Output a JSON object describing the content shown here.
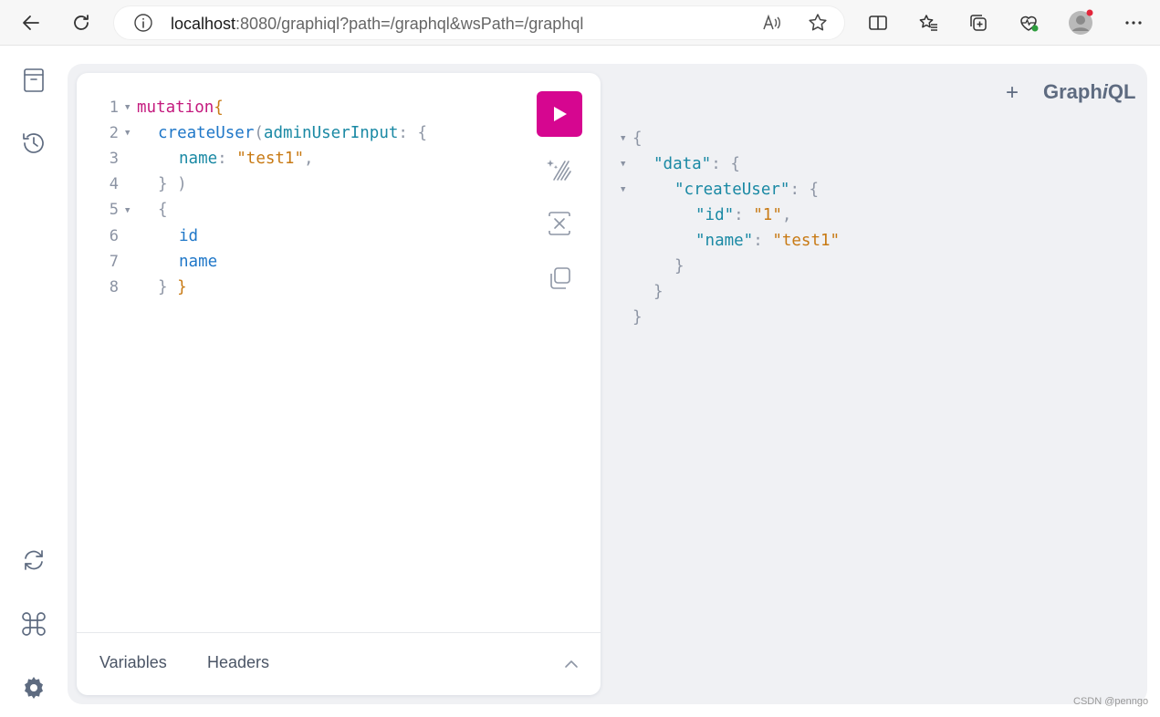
{
  "browser": {
    "url_host": "localhost",
    "url_rest": ":8080/graphiql?path=/graphql&wsPath=/graphql",
    "icons": [
      "back-icon",
      "refresh-icon",
      "info-icon",
      "read-aloud-icon",
      "favorite-star-icon",
      "split-screen-icon",
      "favorites-icon",
      "collections-icon",
      "performance-icon",
      "profile-avatar",
      "more-icon"
    ]
  },
  "sidebar": {
    "items": [
      "docs-icon",
      "history-icon",
      "refetch-schema-icon",
      "shortcuts-icon",
      "settings-icon"
    ]
  },
  "editor": {
    "line_numbers": [
      "1",
      "2",
      "3",
      "4",
      "5",
      "6",
      "7",
      "8"
    ],
    "l1_kw": "mutation",
    "l1_brace": "{",
    "l2_field": "createUser",
    "l2_paren": "(",
    "l2_arg": "adminUserInput",
    "l2_colon": ":",
    "l2_brace": "{",
    "l3_arg": "name",
    "l3_colon": ":",
    "l3_str": "\"test1\"",
    "l3_comma": ",",
    "l4_close": "} )",
    "l5_brace": "{",
    "l6_field": "id",
    "l7_field": "name",
    "l8_inner": "}",
    "l8_outer": "}"
  },
  "footer": {
    "variables_label": "Variables",
    "headers_label": "Headers"
  },
  "brand": {
    "prefix": "Graph",
    "italic": "i",
    "suffix": "QL",
    "plus": "+"
  },
  "result": {
    "open": "{",
    "data_key": "\"data\"",
    "colon1": ":",
    "brace1": "{",
    "create_key": "\"createUser\"",
    "colon2": ":",
    "brace2": "{",
    "id_key": "\"id\"",
    "colon3": ":",
    "id_val": "\"1\"",
    "comma3": ",",
    "name_key": "\"name\"",
    "colon4": ":",
    "name_val": "\"test1\"",
    "close1": "}",
    "close2": "}",
    "close3": "}"
  },
  "colors": {
    "run_button": "#d60690",
    "keyword": "#c41a7e",
    "field": "#1f77c8",
    "string": "#c87a14"
  },
  "watermark": "CSDN @penngo"
}
